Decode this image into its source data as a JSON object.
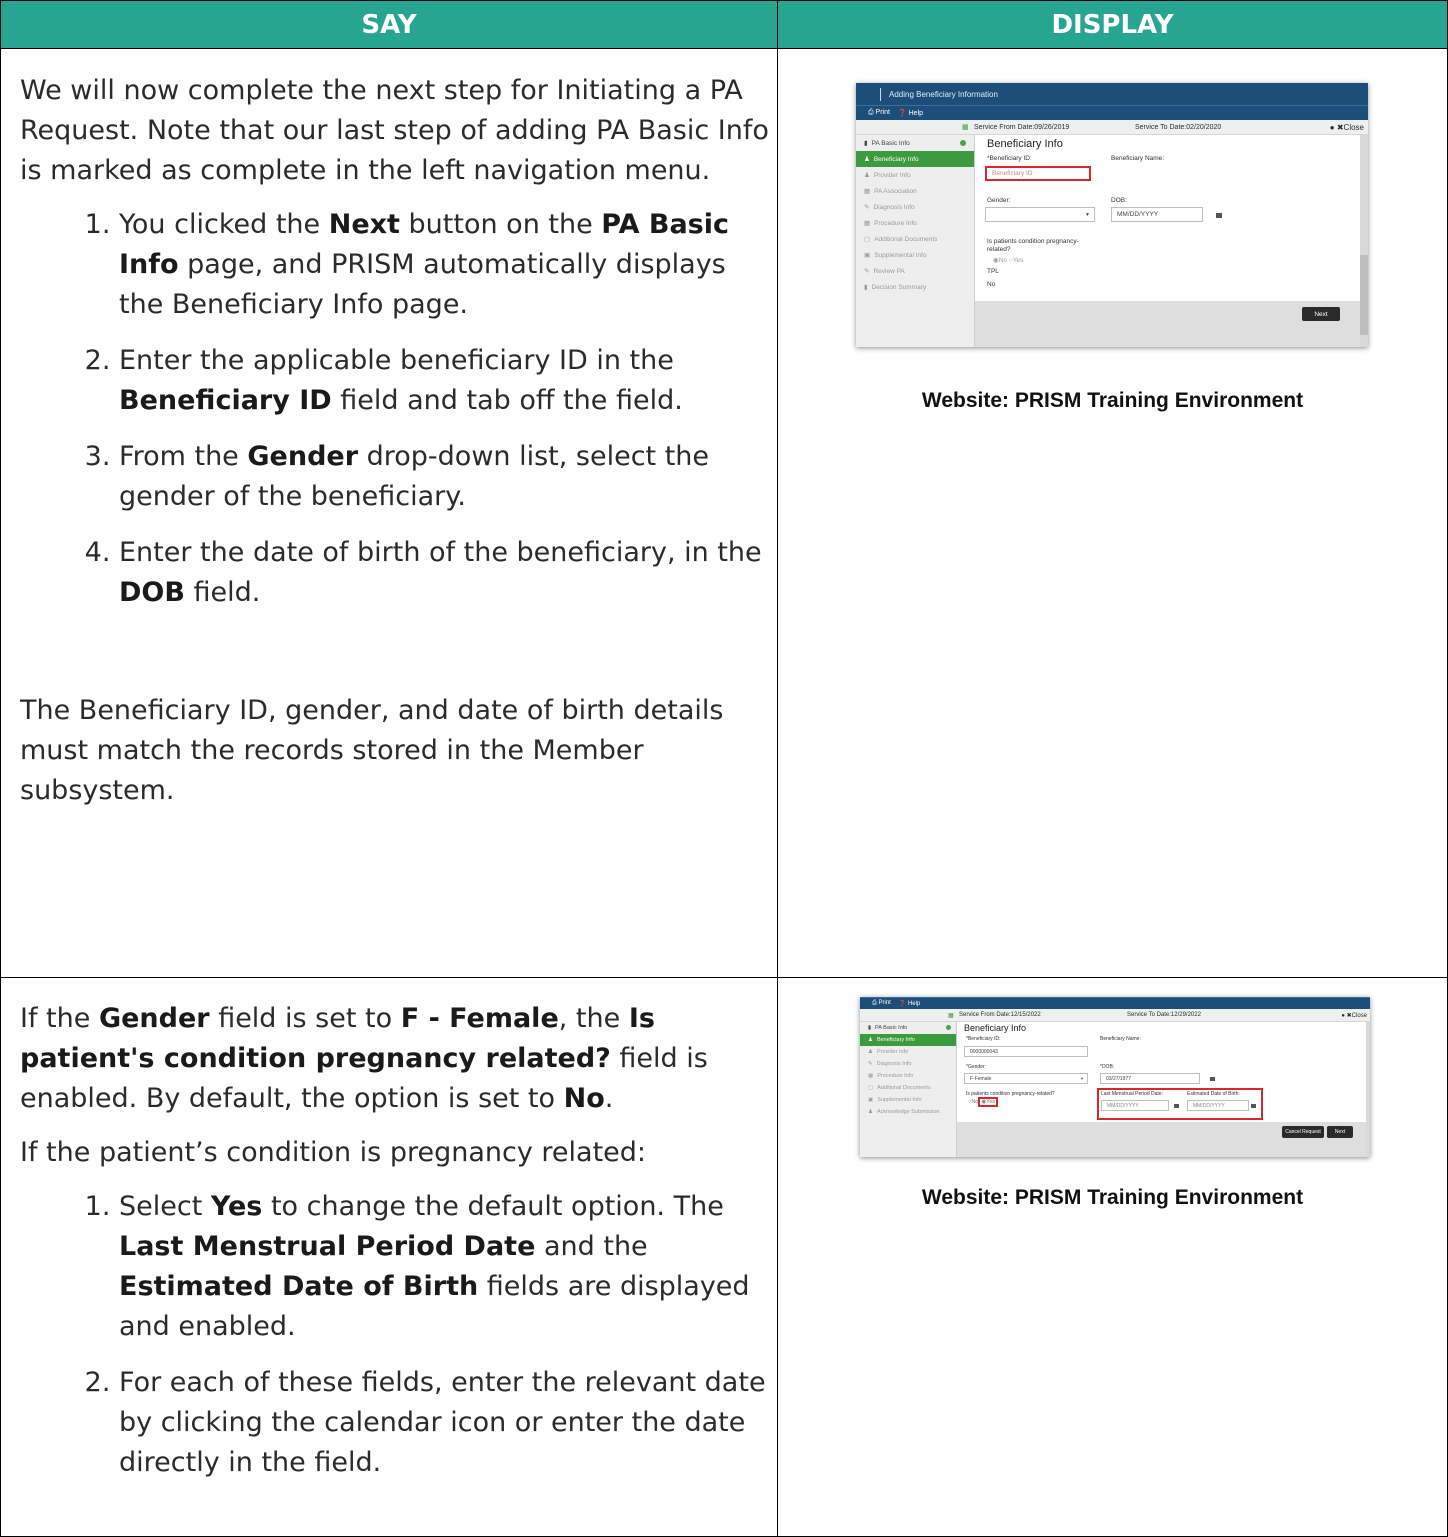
{
  "header": {
    "say": "SAY",
    "display": "DISPLAY"
  },
  "row1": {
    "intro": "We will now complete the next step for Initiating a PA Request. Note that our last step of adding PA Basic Info is marked as complete in the left navigation menu.",
    "steps": {
      "s1_a": "You clicked the ",
      "s1_b": "Next",
      "s1_c": " button on the ",
      "s1_d": "PA Basic Info",
      "s1_e": " page, and PRISM automatically displays the Beneficiary Info page.",
      "s2_a": "Enter the applicable beneficiary ID in the ",
      "s2_b": "Beneficiary ID",
      "s2_c": " field and tab off the field.",
      "s3_a": "From the ",
      "s3_b": "Gender",
      "s3_c": " drop-down list, select the gender of the beneficiary.",
      "s4_a": "Enter the date of birth of the beneficiary, in the ",
      "s4_b": "DOB",
      "s4_c": " field."
    },
    "closing": "The Beneficiary ID, gender, and date of birth details must match the records stored in the Member subsystem.",
    "caption": "Website: PRISM Training Environment",
    "shot": {
      "title": "Adding Beneficiary Information",
      "print": "Print",
      "help": "Help",
      "service_from": "Service From Date:09/26/2019",
      "service_to": "Service To Date:02/20/2020",
      "close": "Close",
      "nav": [
        "PA Basic Info",
        "Beneficiary Info",
        "Provider Info",
        "PA Association",
        "Diagnosis Info",
        "Procedure Info",
        "Additional Documents",
        "Supplemental Info",
        "Review PA",
        "Decision Summary"
      ],
      "heading": "Beneficiary Info",
      "beneficiary_id_label": "*Beneficiary ID:",
      "beneficiary_id_placeholder": "Beneficiary ID",
      "beneficiary_name_label": "Beneficiary Name:",
      "gender_label": "Gender:",
      "dob_label": "DOB:",
      "dob_placeholder": "MM/DD/YYYY",
      "pregnancy_q1": "Is patients condition pregnancy-",
      "pregnancy_q2": "related?",
      "radio_no": "No",
      "radio_yes": "Yes",
      "tpl_label": "TPL",
      "tpl_value": "No",
      "next": "Next"
    }
  },
  "row2": {
    "p1": {
      "a": "If the ",
      "b": "Gender",
      "c": " field is set to ",
      "d": "F - Female",
      "e": ", the ",
      "f": "Is patient's condition pregnancy related?",
      "g": " field is enabled. By default, the option is set to ",
      "h": "No",
      "i": "."
    },
    "p2": "If the patient’s condition is pregnancy related:",
    "steps": {
      "s1_a": "Select ",
      "s1_b": "Yes",
      "s1_c": " to change the default option. The ",
      "s1_d": "Last Menstrual Period Date",
      "s1_e": " and the ",
      "s1_f": "Estimated Date of Birth",
      "s1_g": " fields are displayed and enabled.",
      "s2": "For each of these fields, enter the relevant date by clicking the calendar icon or enter the date directly in the field."
    },
    "caption": "Website: PRISM Training Environment",
    "shot": {
      "print": "Print",
      "help": "Help",
      "service_from": "Service From Date:12/15/2022",
      "service_to": "Service To Date:12/29/2022",
      "close": "Close",
      "nav": [
        "PA Basic Info",
        "Beneficiary Info",
        "Provider Info",
        "Diagnosis Info",
        "Procedure Info",
        "Additional Documents",
        "Supplemental Info",
        "Acknowledge Submission"
      ],
      "heading": "Beneficiary Info",
      "beneficiary_id_label": "*Beneficiary ID:",
      "beneficiary_id_value": "0000000043",
      "beneficiary_name_label": "Beneficiary Name:",
      "gender_label": "*Gender:",
      "gender_value": "F-Female",
      "dob_label": "*DOB:",
      "dob_value": "03/27/1977",
      "pregnancy_q": "Is patients condition pregnancy-related?",
      "radio_no": "No",
      "radio_yes": "Yes",
      "lmp_label": "Last Menstrual Period Date:",
      "edb_label": "Estimated Date of Birth:",
      "date_placeholder": "MM/DD/YYYY",
      "cancel": "Cancel Request",
      "next": "Next"
    }
  }
}
